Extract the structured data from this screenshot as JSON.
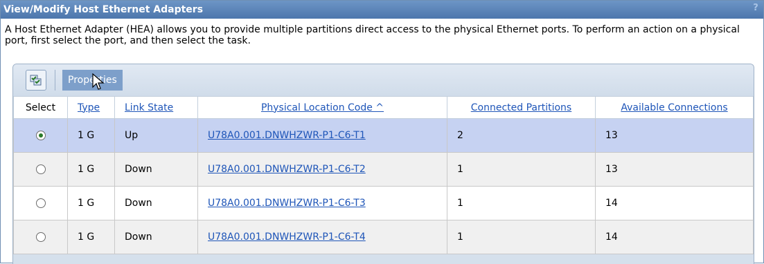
{
  "window": {
    "title": "View/Modify Host Ethernet Adapters",
    "help_label": "?"
  },
  "description": "A Host Ethernet Adapter (HEA) allows you to provide multiple partitions direct access to the physical Ethernet ports. To perform an action on a physical port, first select the port, and then select the task.",
  "toolbar": {
    "icon": "select-all-icon",
    "properties_label": "Properties"
  },
  "table": {
    "headers": {
      "select": "Select",
      "type": "Type",
      "link_state": "Link State",
      "physical_location": "Physical Location Code ^",
      "connected_partitions": "Connected Partitions",
      "available_connections": "Available Connections"
    },
    "rows": [
      {
        "selected": true,
        "type": "1 G",
        "link_state": "Up",
        "physical_location": "U78A0.001.DNWHZWR-P1-C6-T1",
        "connected_partitions": "2",
        "available_connections": "13"
      },
      {
        "selected": false,
        "type": "1 G",
        "link_state": "Down",
        "physical_location": "U78A0.001.DNWHZWR-P1-C6-T2",
        "connected_partitions": "1",
        "available_connections": "13"
      },
      {
        "selected": false,
        "type": "1 G",
        "link_state": "Down",
        "physical_location": "U78A0.001.DNWHZWR-P1-C6-T3",
        "connected_partitions": "1",
        "available_connections": "14"
      },
      {
        "selected": false,
        "type": "1 G",
        "link_state": "Down",
        "physical_location": "U78A0.001.DNWHZWR-P1-C6-T4",
        "connected_partitions": "1",
        "available_connections": "14"
      }
    ]
  },
  "colors": {
    "title_bar": "#4c76ac",
    "selected_row": "#c6d2f2",
    "link": "#1e55b8"
  }
}
